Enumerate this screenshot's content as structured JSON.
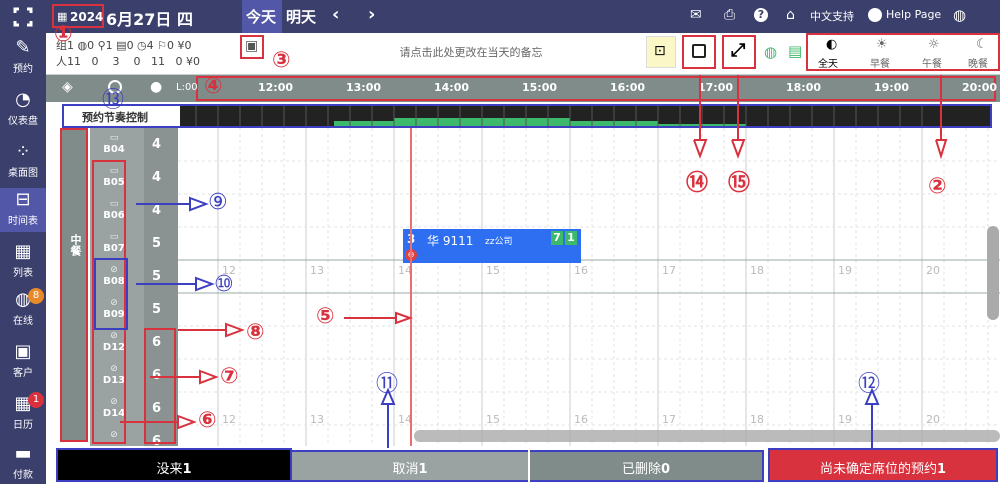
{
  "top": {
    "year": "2024",
    "date": "6月27日 四",
    "tabs": [
      "今天",
      "明天"
    ],
    "support": "中文支持",
    "help": "Help Page"
  },
  "sidebar": [
    {
      "label": "预约",
      "icon": "edit-icon"
    },
    {
      "label": "仪表盘",
      "icon": "dashboard-icon"
    },
    {
      "label": "桌面图",
      "icon": "table-map-icon"
    },
    {
      "label": "时间表",
      "icon": "timeline-icon"
    },
    {
      "label": "列表",
      "icon": "list-icon"
    },
    {
      "label": "在线",
      "icon": "globe-icon",
      "badge": "8"
    },
    {
      "label": "客户",
      "icon": "customer-icon"
    },
    {
      "label": "日历",
      "icon": "calendar-icon",
      "badge": "1"
    },
    {
      "label": "付款",
      "icon": "payment-icon"
    }
  ],
  "stats": {
    "row1": [
      "组1",
      "0",
      "1",
      "0",
      "4",
      "0",
      "¥0"
    ],
    "row2_label": "人",
    "row2": [
      "11",
      "0",
      "3",
      "0",
      "11",
      "0",
      "¥0"
    ]
  },
  "memo_placeholder": "请点击此处更改在当天的备忘",
  "meal_filters": [
    "全天",
    "早餐",
    "午餐",
    "晚餐"
  ],
  "rhythm_label": "预约节奏控制",
  "times": [
    "12:00",
    "13:00",
    "14:00",
    "15:00",
    "16:00",
    "17:00",
    "18:00",
    "19:00",
    "20:00"
  ],
  "time_first_label": "L:00",
  "grid_hour_numbers": [
    "12",
    "13",
    "14",
    "15",
    "16",
    "17",
    "18",
    "19",
    "20"
  ],
  "section_label": "中餐",
  "tables": [
    {
      "name": "B04",
      "cap": "4"
    },
    {
      "name": "B05",
      "cap": "4"
    },
    {
      "name": "B06",
      "cap": "4"
    },
    {
      "name": "B07",
      "cap": "5"
    },
    {
      "name": "B08",
      "cap": "5"
    },
    {
      "name": "B09",
      "cap": "5"
    },
    {
      "name": "D12",
      "cap": "6"
    },
    {
      "name": "D13",
      "cap": "6"
    },
    {
      "name": "D14",
      "cap": "6"
    },
    {
      "name": "",
      "cap": "6"
    }
  ],
  "reservation": {
    "count": "3",
    "name": "华 9111",
    "company": "zz公司",
    "tag1": "7",
    "tag2": "1"
  },
  "bottom": [
    {
      "label": "没来",
      "count": "1"
    },
    {
      "label": "取消",
      "count": "1"
    },
    {
      "label": "已删除",
      "count": "0"
    },
    {
      "label": "尚未确定席位的预约",
      "count": "1"
    }
  ],
  "annotations": {
    "red": [
      "①",
      "②",
      "③",
      "④",
      "⑤",
      "⑥",
      "⑦",
      "⑧",
      "⑭",
      "⑮"
    ],
    "blue": [
      "⑨",
      "⑩",
      "⑪",
      "⑫",
      "⑬"
    ]
  },
  "chart_data": {
    "type": "bar",
    "title": "",
    "xlabel": "",
    "ylabel": "",
    "categories": [
      "12:00",
      "13:00",
      "14:00",
      "15:00",
      "16:00",
      "17:00",
      "18:00",
      "19:00",
      "20:00"
    ],
    "values": [
      0,
      0.3,
      0.5,
      0.5,
      0.3,
      0.15,
      0,
      0,
      0
    ],
    "ylim": [
      0,
      1
    ],
    "grid": true,
    "legend": "none"
  },
  "colors": {
    "sidebar": "#3a3f6b",
    "accent_red": "#d9323f",
    "accent_blue": "#3b3fc0",
    "reservation": "#2d6ff0",
    "green": "#3cb96a"
  }
}
